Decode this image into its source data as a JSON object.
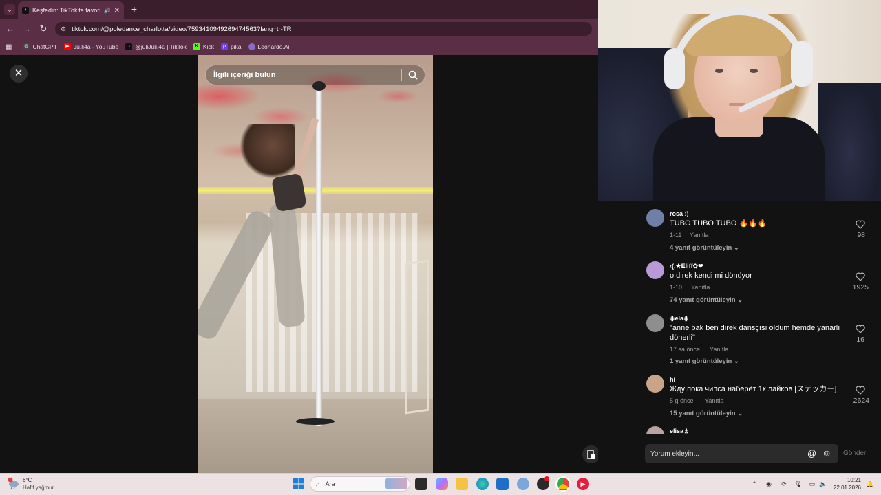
{
  "browser": {
    "tab_title": "Keşfedin: TikTok'ta favori vid",
    "url": "tiktok.com/@poledance_charlotta/video/7593410949269474563?lang=tr-TR",
    "bookmarks": [
      {
        "label": "ChatGPT",
        "icon": "chatgpt-icon",
        "color": "#444444"
      },
      {
        "label": "Ju.li4a - YouTube",
        "icon": "youtube-icon",
        "color": "#ff0000"
      },
      {
        "label": "@juliJuli.4a | TikTok",
        "icon": "tiktok-icon",
        "color": "#111111"
      },
      {
        "label": "Kick",
        "icon": "kick-icon",
        "color": "#53fc18"
      },
      {
        "label": "pika",
        "icon": "pika-icon",
        "color": "#6a3df0"
      },
      {
        "label": "Leonardo.Ai",
        "icon": "leonardo-icon",
        "color": "#8a6cc8"
      }
    ]
  },
  "video_page": {
    "search_placeholder": "İlgili içeriği bulun"
  },
  "comments": [
    {
      "user": "rosa :)",
      "text": "TUBO TUBO TUBO 🔥🔥🔥",
      "date": "1-11",
      "reply": "Yanıtla",
      "likes": "98",
      "view_replies": "4 yanıt görüntüleyin",
      "avatar_color": "#6f7fa8"
    },
    {
      "user": "‹(.★Eliff✿❤",
      "text": "o direk kendi mi dönüyor",
      "date": "1-10",
      "reply": "Yanıtla",
      "likes": "1925",
      "view_replies": "74 yanıt görüntüleyin",
      "avatar_color": "#b79ad6"
    },
    {
      "user": "⋕ela⋕",
      "text": "\"anne bak ben direk dansçısı oldum hemde yanarlı dönerli\"",
      "date": "17 sa önce",
      "reply": "Yanıtla",
      "likes": "16",
      "view_replies": "1 yanıt görüntüleyin",
      "avatar_color": "#8e8e8e"
    },
    {
      "user": "hi",
      "text": "Жду пока чипса наберёт 1к лайков [ステッカー]",
      "date": "5 g önce",
      "reply": "Yanıtla",
      "likes": "2624",
      "view_replies": "15 yanıt görüntüleyin",
      "avatar_color": "#c8a58a"
    },
    {
      "user": "elisa♗",
      "avatar_color": "#b9a3a0"
    }
  ],
  "comment_input": {
    "placeholder": "Yorum ekleyin...",
    "send_label": "Gönder"
  },
  "taskbar": {
    "temperature": "6°C",
    "weather": "Hafif yağmur",
    "weather_badge": "7",
    "search_placeholder": "Ara",
    "time": "10:21",
    "date": "22.01.2026"
  }
}
